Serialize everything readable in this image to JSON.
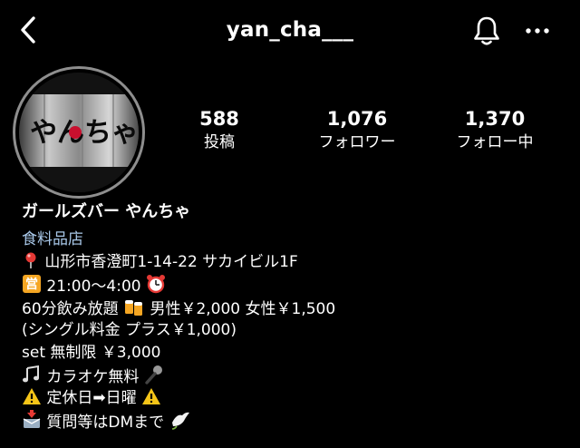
{
  "header": {
    "username": "yan_cha___",
    "back_icon": "chevron-left-icon",
    "notification_icon": "bell-icon",
    "more_icon": "more-horizontal-icon"
  },
  "avatar": {
    "sign_text": "やんちゃ"
  },
  "stats": {
    "posts": {
      "value": "588",
      "label": "投稿"
    },
    "followers": {
      "value": "1,076",
      "label": "フォロワー"
    },
    "following": {
      "value": "1,370",
      "label": "フォロー中"
    }
  },
  "bio": {
    "name": "ガールズバー やんちゃ",
    "category": "食料品店",
    "address": "山形市香澄町1-14-22 サカイビル1F",
    "hours": "21:00～4:00",
    "price_line": "60分飲み放題",
    "price_detail": "男性￥2,000 女性￥1,500",
    "single_fee": "(シングル料金 プラス￥1,000)",
    "set_line": "set 無制限 ￥3,000",
    "karaoke": "カラオケ無料",
    "holiday": "定休日➡日曜",
    "dm": "質問等はDMまで",
    "business_badge": "営"
  },
  "colors": {
    "background": "#000000",
    "text": "#ffffff",
    "category_link": "#a8c7e8",
    "avatar_ring": "#8e8e8e"
  }
}
